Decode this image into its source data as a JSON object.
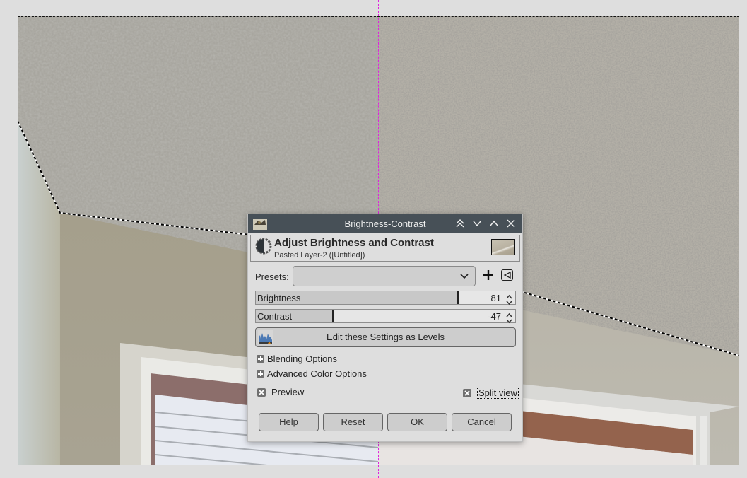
{
  "canvas": {
    "guide_color": "#e020e0",
    "selection_color": "#111111"
  },
  "dialog": {
    "window_title": "Brightness-Contrast",
    "titlebar_buttons": [
      "keep-above",
      "minimize",
      "maximize",
      "close"
    ],
    "header": {
      "title": "Adjust Brightness and Contrast",
      "subtitle": "Pasted Layer-2 ([Untitled])"
    },
    "presets": {
      "label": "Presets:",
      "value": ""
    },
    "brightness": {
      "label": "Brightness",
      "value": "81",
      "min": -127,
      "max": 127
    },
    "contrast": {
      "label": "Contrast",
      "value": "-47",
      "min": -127,
      "max": 127
    },
    "levels_button": "Edit these Settings as Levels",
    "expanders": [
      "Blending Options",
      "Advanced Color Options"
    ],
    "preview": {
      "label": "Preview",
      "checked": true
    },
    "split_view": {
      "label": "Split view",
      "checked": true
    },
    "buttons": {
      "help": "Help",
      "reset": "Reset",
      "ok": "OK",
      "cancel": "Cancel"
    }
  }
}
